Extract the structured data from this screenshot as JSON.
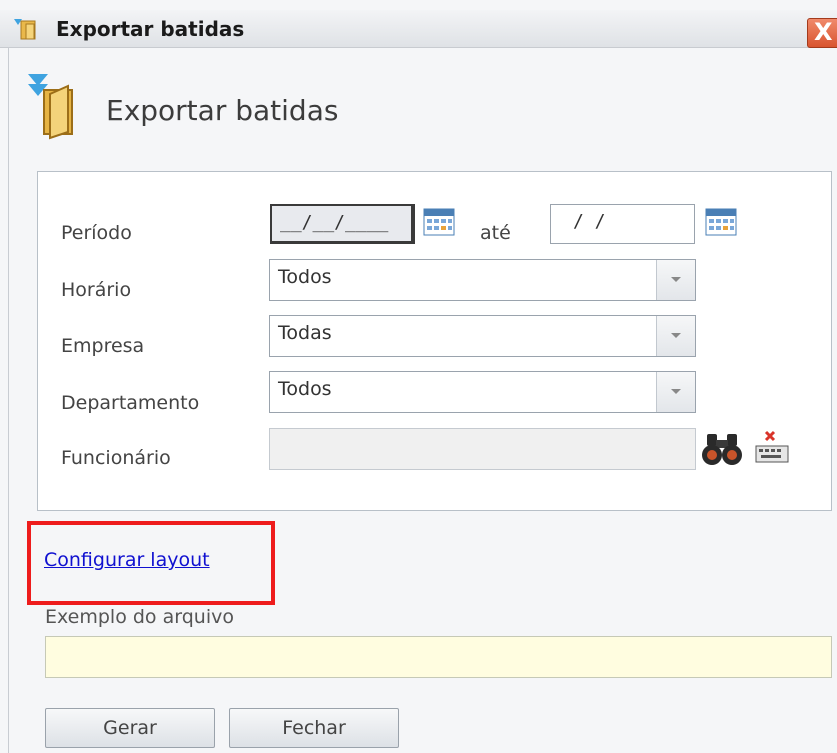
{
  "window": {
    "title": "Exportar batidas",
    "close_label": "X"
  },
  "header": {
    "title": "Exportar batidas"
  },
  "form": {
    "periodo": {
      "label": "Período",
      "start_value": "__/__/____",
      "connector": "até",
      "end_value": "/ /"
    },
    "horario": {
      "label": "Horário",
      "value": "Todos"
    },
    "empresa": {
      "label": "Empresa",
      "value": "Todas"
    },
    "departamento": {
      "label": "Departamento",
      "value": "Todos"
    },
    "funcionario": {
      "label": "Funcionário",
      "value": ""
    }
  },
  "layout_link": "Configurar layout",
  "example": {
    "label": "Exemplo do arquivo",
    "value": ""
  },
  "buttons": {
    "generate": "Gerar",
    "close": "Fechar"
  },
  "icons": {
    "window": "export-punches-icon",
    "header": "export-punches-icon",
    "calendar": "calendar-icon",
    "search": "binoculars-icon",
    "clear": "keyboard-clear-icon"
  },
  "colors": {
    "highlight": "#ee1c1c",
    "link": "#1010d0",
    "example_bg": "#fffde0"
  }
}
